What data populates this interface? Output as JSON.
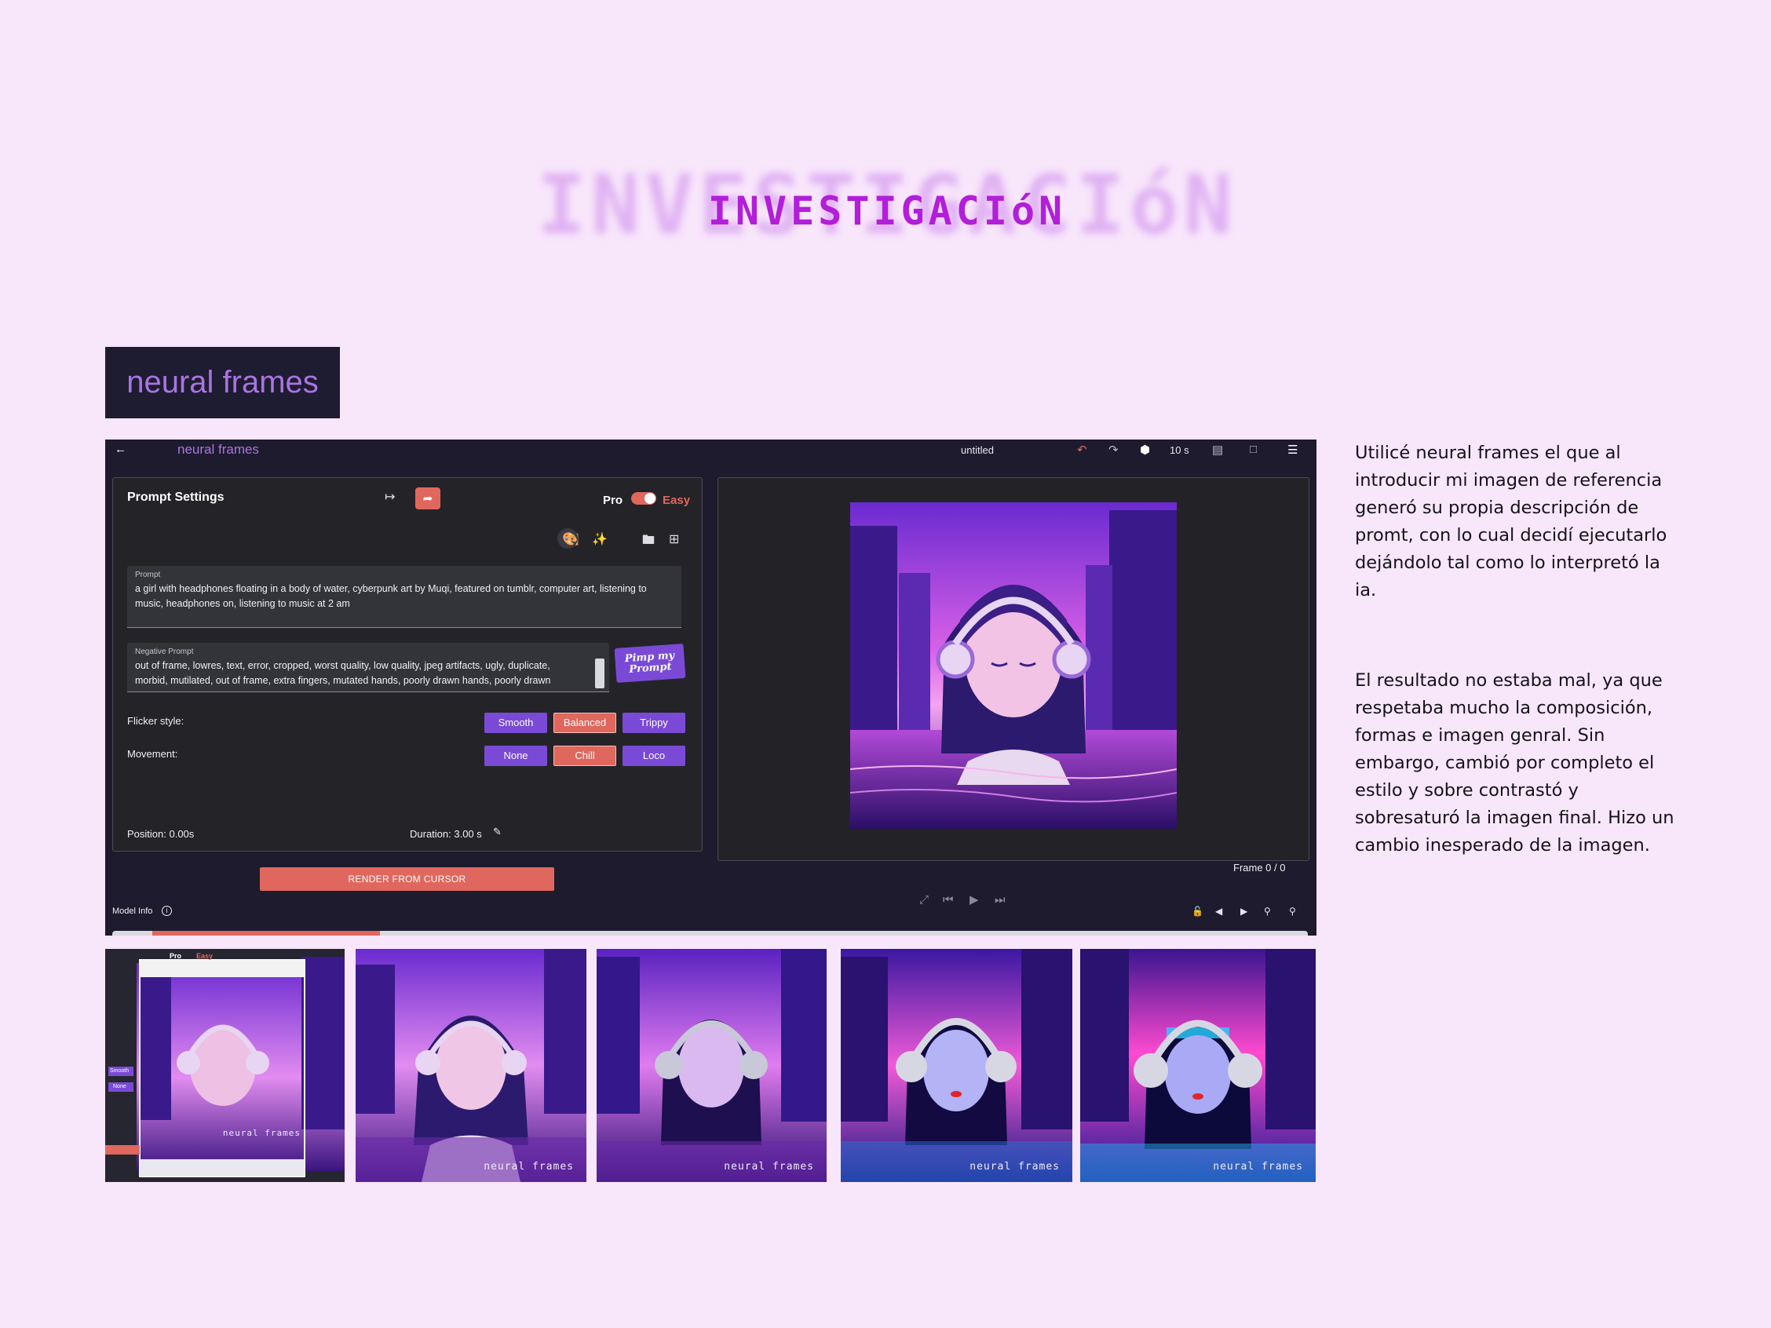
{
  "heading": {
    "title": "INVESTIGACIóN"
  },
  "logo": {
    "text": "neural frames"
  },
  "app": {
    "brand": "neural frames",
    "document_title": "untitled",
    "duration_total": "10 s",
    "prompt_settings": {
      "title": "Prompt Settings",
      "mode_pro": "Pro",
      "mode_easy": "Easy",
      "prompt_label": "Prompt",
      "prompt_text": "a girl with headphones floating in a body of water, cyberpunk art by Muqi, featured on tumblr, computer art, listening to music, headphones on, listening to music at 2 am",
      "negative_label": "Negative Prompt",
      "negative_text": "out of frame, lowres, text, error, cropped, worst quality, low quality, jpeg artifacts, ugly, duplicate, morbid, mutilated, out of frame, extra fingers, mutated hands, poorly drawn hands, poorly drawn",
      "pimp_button": "Pimp my Prompt",
      "flicker_label": "Flicker style:",
      "flicker_options": [
        "Smooth",
        "Balanced",
        "Trippy"
      ],
      "flicker_selected": "Balanced",
      "movement_label": "Movement:",
      "movement_options": [
        "None",
        "Chill",
        "Loco"
      ],
      "movement_selected": "Chill",
      "position": "Position:  0.00s",
      "duration": "Duration: 3.00 s"
    },
    "render_button": "RENDER FROM CURSOR",
    "frame_counter": "Frame 0 / 0",
    "model_info": "Model Info",
    "icons": [
      "back-arrow-icon",
      "undo-icon",
      "redo-icon",
      "settings-icon",
      "save-icon",
      "export-icon",
      "menu-icon",
      "collapse-icon",
      "share-icon",
      "clipboard-icon",
      "magic-wand-icon",
      "palette-icon",
      "folder-icon",
      "add-image-icon",
      "expand-icon",
      "skip-back-icon",
      "play-icon",
      "skip-forward-icon",
      "lock-icon",
      "zoom-out-icon",
      "zoom-in-icon"
    ]
  },
  "description": {
    "paragraph1": "Utilicé neural frames el que al introducir mi imagen de referencia generó su propia descripción de promt, con lo cual decidí ejecutarlo dejándolo tal como lo interpretó la ia.",
    "paragraph2": "El resultado no estaba mal, ya que respetaba mucho la composición, formas e imagen genral. Sin embargo, cambió por completo el estilo y sobre contrastó y sobresaturó la imagen final. Hizo un cambio inesperado de la imagen."
  },
  "thumbnails": {
    "watermark": "neural frames",
    "mini_window": {
      "mode_pro": "Pro",
      "mode_easy": "Easy",
      "flicker": "Smooth",
      "movement": "None"
    }
  },
  "colors": {
    "accent_purple": "#7a4ad7",
    "accent_coral": "#e0675e",
    "heading_magenta": "#b21ed9",
    "page_bg": "#f8e6fb",
    "app_bg": "#1d1b2d"
  }
}
